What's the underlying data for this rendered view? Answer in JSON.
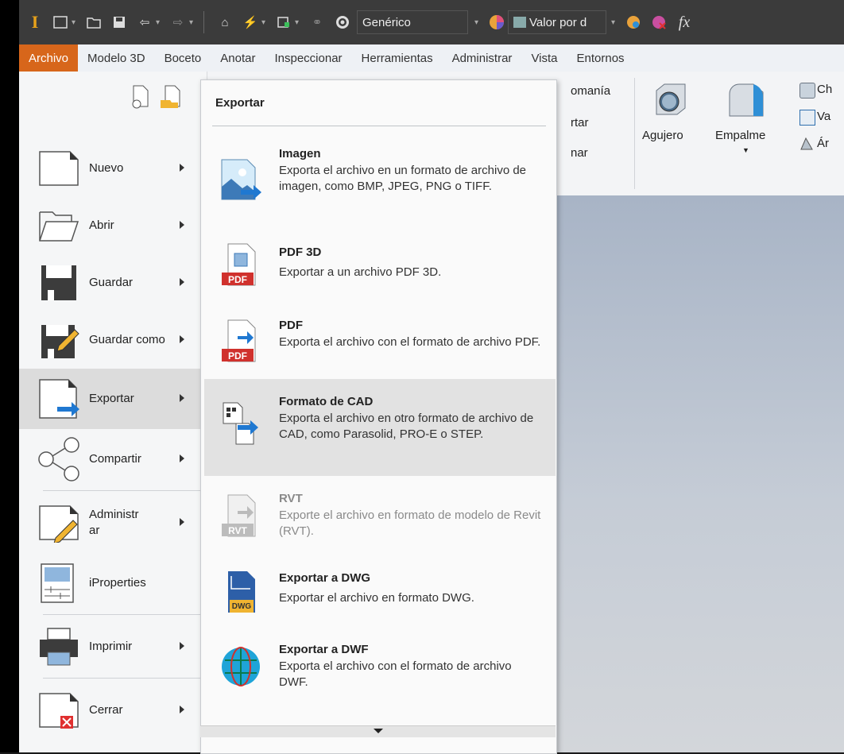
{
  "quick_access": {
    "app_letter": "I",
    "appearance_combo": "Genérico",
    "value_combo": "Valor por d",
    "fx_label": "fx"
  },
  "menubar": {
    "tabs": [
      "Archivo",
      "Modelo 3D",
      "Boceto",
      "Anotar",
      "Inspeccionar",
      "Herramientas",
      "Administrar",
      "Vista",
      "Entornos"
    ]
  },
  "ribbon": {
    "partial_labels": [
      "omanía",
      "rtar",
      "nar"
    ],
    "hole_label": "Agujero",
    "fillet_label": "Empalme",
    "right_labels": [
      "Ch",
      "Va",
      "Ár"
    ]
  },
  "app_menu": {
    "items": [
      {
        "label": "Nuevo",
        "icon": "new-document-icon"
      },
      {
        "label": "Abrir",
        "icon": "open-folder-icon"
      },
      {
        "label": "Guardar",
        "icon": "save-floppy-icon"
      },
      {
        "label": "Guardar como",
        "icon": "save-as-icon"
      },
      {
        "label": "Exportar",
        "icon": "export-icon"
      },
      {
        "label": "Compartir",
        "icon": "share-icon"
      },
      {
        "label": "Administrar",
        "icon": "manage-icon"
      },
      {
        "label": "iProperties",
        "icon": "iproperties-icon"
      },
      {
        "label": "Imprimir",
        "icon": "printer-icon"
      },
      {
        "label": "Cerrar",
        "icon": "close-document-icon"
      }
    ]
  },
  "export_menu": {
    "title": "Exportar",
    "items": [
      {
        "title": "Imagen",
        "desc": "Exporta el archivo en un formato de archivo de imagen, como BMP, JPEG, PNG o TIFF."
      },
      {
        "title": "PDF 3D",
        "desc": "Exportar a un archivo PDF 3D."
      },
      {
        "title": "PDF",
        "desc": "Exporta el archivo con el formato de archivo PDF."
      },
      {
        "title": "Formato de CAD",
        "desc": "Exporta el archivo en otro formato de archivo de CAD, como Parasolid, PRO-E o STEP."
      },
      {
        "title": "RVT",
        "desc": "Exporte el archivo en formato de modelo de Revit (RVT)."
      },
      {
        "title": "Exportar a DWG",
        "desc": "Exportar el archivo en formato DWG."
      },
      {
        "title": "Exportar a DWF",
        "desc": "Exporta el archivo con el formato de archivo DWF."
      }
    ],
    "icon_text": {
      "pdf": "PDF",
      "rvt": "RVT",
      "dwg": "DWG"
    }
  },
  "colors": {
    "active_tab": "#d7661b",
    "export_arrow": "#1f78d1"
  }
}
